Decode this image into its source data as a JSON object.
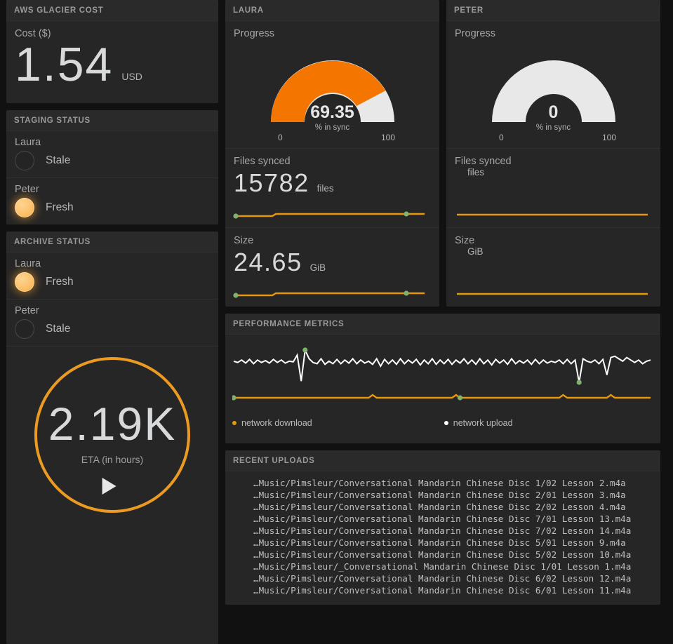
{
  "cost_panel": {
    "title": "AWS GLACIER COST",
    "label": "Cost ($)",
    "value": "1.54",
    "unit": "USD"
  },
  "staging_status": {
    "title": "STAGING STATUS",
    "rows": [
      {
        "name": "Laura",
        "state": "Stale",
        "on": false
      },
      {
        "name": "Peter",
        "state": "Fresh",
        "on": true
      }
    ]
  },
  "archive_status": {
    "title": "ARCHIVE STATUS",
    "rows": [
      {
        "name": "Laura",
        "state": "Fresh",
        "on": true
      },
      {
        "name": "Peter",
        "state": "Stale",
        "on": false
      }
    ]
  },
  "eta_panel": {
    "value": "2.19K",
    "label": "ETA (in hours)",
    "accent": "#eb9a22"
  },
  "laura": {
    "title": "LAURA",
    "progress_label": "Progress",
    "gauge": {
      "value": "69.35",
      "unit": "% in sync",
      "min": "0",
      "max": "100",
      "percent": 69.35,
      "fill_color": "#f47600",
      "track_color": "#e8e8e8"
    },
    "files": {
      "label": "Files synced",
      "value": "15782",
      "unit": "files"
    },
    "size": {
      "label": "Size",
      "value": "24.65",
      "unit": "GiB"
    }
  },
  "peter": {
    "title": "PETER",
    "progress_label": "Progress",
    "gauge": {
      "value": "0",
      "unit": "% in sync",
      "min": "0",
      "max": "100",
      "percent": 0,
      "fill_color": "#f47600",
      "track_color": "#e8e8e8"
    },
    "files": {
      "label": "Files synced",
      "value": "",
      "unit": "files"
    },
    "size": {
      "label": "Size",
      "value": "",
      "unit": "GiB"
    }
  },
  "performance": {
    "title": "PERFORMANCE METRICS",
    "legend": [
      {
        "label": "network download",
        "color": "#e8960c"
      },
      {
        "label": "network upload",
        "color": "#ffffff"
      }
    ]
  },
  "recent_uploads": {
    "title": "RECENT UPLOADS",
    "items": [
      "…Music/Pimsleur/Conversational Mandarin Chinese Disc 1/02 Lesson 2.m4a",
      "…Music/Pimsleur/Conversational Mandarin Chinese Disc 2/01 Lesson 3.m4a",
      "…Music/Pimsleur/Conversational Mandarin Chinese Disc 2/02 Lesson 4.m4a",
      "…Music/Pimsleur/Conversational Mandarin Chinese Disc 7/01 Lesson 13.m4a",
      "…Music/Pimsleur/Conversational Mandarin Chinese Disc 7/02 Lesson 14.m4a",
      "…Music/Pimsleur/Conversational Mandarin Chinese Disc 5/01 Lesson 9.m4a",
      "…Music/Pimsleur/Conversational Mandarin Chinese Disc 5/02 Lesson 10.m4a",
      "…Music/Pimsleur/_Conversational Mandarin Chinese Disc 1/01 Lesson 1.m4a",
      "…Music/Pimsleur/Conversational Mandarin Chinese Disc 6/02 Lesson 12.m4a",
      "…Music/Pimsleur/Conversational Mandarin Chinese Disc 6/01 Lesson 11.m4a"
    ]
  },
  "chart_data": [
    {
      "type": "line",
      "title": "PERFORMANCE METRICS",
      "series": [
        {
          "name": "network upload",
          "color": "#ffffff",
          "values": [
            52,
            50,
            54,
            49,
            55,
            48,
            54,
            50,
            53,
            49,
            55,
            50,
            54,
            49,
            52,
            51,
            62,
            20,
            70,
            56,
            50,
            48,
            56,
            47,
            52,
            48,
            55,
            48,
            54,
            49,
            56,
            48,
            54,
            49,
            52,
            47,
            56,
            44,
            55,
            48,
            54,
            47,
            56,
            48,
            54,
            49,
            55,
            46,
            54,
            48,
            56,
            47,
            54,
            48,
            55,
            47,
            54,
            49,
            56,
            48,
            54,
            47,
            56,
            48,
            54,
            46,
            55,
            49,
            54,
            47,
            56,
            48,
            53,
            49,
            54,
            47,
            55,
            48,
            54,
            49,
            52,
            50,
            54,
            48,
            55,
            48,
            54,
            18,
            56,
            52,
            50,
            54,
            48,
            55,
            30,
            58,
            60,
            56,
            52,
            58,
            54,
            50,
            54,
            48,
            52,
            54
          ]
        },
        {
          "name": "network download",
          "color": "#e8960c",
          "values": [
            3,
            3,
            3,
            3,
            3,
            3,
            3,
            3,
            3,
            3,
            3,
            3,
            3,
            3,
            3,
            3,
            3,
            3,
            3,
            3,
            3,
            3,
            3,
            3,
            3,
            3,
            3,
            3,
            3,
            3,
            3,
            3,
            3,
            3,
            3,
            6,
            3,
            3,
            3,
            3,
            3,
            3,
            3,
            3,
            3,
            3,
            3,
            3,
            3,
            3,
            3,
            3,
            3,
            3,
            3,
            3,
            6,
            3,
            3,
            3,
            3,
            3,
            3,
            3,
            3,
            3,
            3,
            3,
            3,
            3,
            3,
            3,
            3,
            3,
            3,
            3,
            3,
            3,
            3,
            3,
            3,
            3,
            3,
            6,
            3,
            3,
            3,
            3,
            3,
            3,
            3,
            3,
            3,
            3,
            3,
            6,
            3,
            3,
            3,
            3,
            3,
            3,
            3,
            3,
            3,
            3
          ]
        }
      ],
      "grid": false,
      "legend_position": "bottom"
    },
    {
      "type": "line",
      "title": "Laura files synced sparkline",
      "values": [
        0,
        0,
        0,
        0,
        0,
        0,
        0,
        0,
        1,
        1,
        1,
        1,
        1,
        1,
        1,
        1,
        1,
        1,
        1,
        1,
        1,
        1,
        1,
        1,
        1,
        1,
        1,
        1,
        1,
        1,
        1,
        1,
        1,
        1,
        1,
        1,
        1,
        1,
        1,
        1
      ],
      "color": "#e8960c"
    },
    {
      "type": "line",
      "title": "Laura size sparkline",
      "values": [
        0,
        0,
        0,
        0,
        0,
        0,
        0,
        0,
        1,
        1,
        1,
        1,
        1,
        1,
        1,
        1,
        1,
        1,
        1,
        1,
        1,
        1,
        1,
        1,
        1,
        1,
        1,
        1,
        1,
        1,
        1,
        1,
        1,
        1,
        1,
        1,
        1,
        1,
        1,
        1
      ],
      "color": "#e8960c"
    },
    {
      "type": "gauge",
      "title": "Laura progress",
      "value": 69.35,
      "min": 0,
      "max": 100,
      "unit": "% in sync"
    },
    {
      "type": "gauge",
      "title": "Peter progress",
      "value": 0,
      "min": 0,
      "max": 100,
      "unit": "% in sync"
    }
  ]
}
